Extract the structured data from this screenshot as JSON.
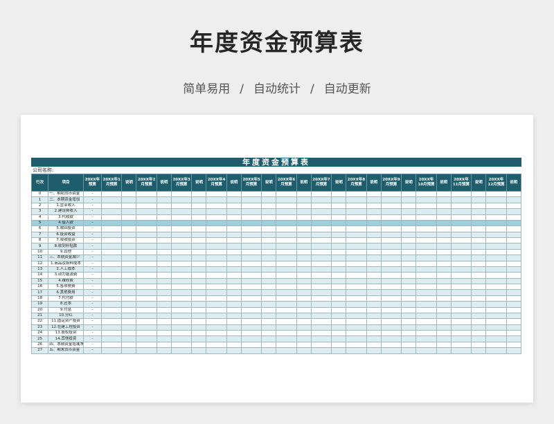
{
  "header": {
    "title": "年度资金预算表",
    "subtitle_parts": [
      "简单易用",
      "自动统计",
      "自动更新"
    ],
    "separator": "/"
  },
  "sheet": {
    "banner_title": "年度资金预算表",
    "company_label": "公司名称:",
    "columns": [
      "行次",
      "项目",
      "20XX年预算",
      "20XX年1月预算",
      "说明",
      "20XX年2月预算",
      "说明",
      "20XX年3月预算",
      "说明",
      "20XX年4月预算",
      "说明",
      "20XX年5月预算",
      "说明",
      "20XX年6月预算",
      "说明",
      "20XX年7月预算",
      "说明",
      "20XX年8月预算",
      "说明",
      "20XX年9月预算",
      "说明",
      "20XX年10月预算",
      "说明",
      "20XX年11月预算",
      "说明",
      "20XX年12月预算",
      "说明"
    ],
    "empty_value": "-",
    "rows": [
      {
        "no": "0",
        "item": "一、期初货币资金",
        "level": 0
      },
      {
        "no": "1",
        "item": "二、本期资金增加",
        "level": 0
      },
      {
        "no": "2",
        "item": "1.营业收入",
        "level": 1
      },
      {
        "no": "3",
        "item": "2.建设费收入",
        "level": 1
      },
      {
        "no": "4",
        "item": "3.代收款",
        "level": 1
      },
      {
        "no": "5",
        "item": "4.借入款",
        "level": 1
      },
      {
        "no": "6",
        "item": "5.收回投资",
        "level": 1
      },
      {
        "no": "7",
        "item": "6.投资收益",
        "level": 1
      },
      {
        "no": "8",
        "item": "7.吸收投资",
        "level": 1
      },
      {
        "no": "9",
        "item": "8.收到补贴款",
        "level": 1
      },
      {
        "no": "10",
        "item": "9.其他",
        "level": 1
      },
      {
        "no": "11",
        "item": "三、本期资金减少",
        "level": 0
      },
      {
        "no": "12",
        "item": "1.商品及拆料成本",
        "level": 1
      },
      {
        "no": "13",
        "item": "2.人工成本",
        "level": 1
      },
      {
        "no": "14",
        "item": "3.动力能源费",
        "level": 1
      },
      {
        "no": "15",
        "item": "4.维修费",
        "level": 1
      },
      {
        "no": "16",
        "item": "5.各项税费",
        "level": 1
      },
      {
        "no": "17",
        "item": "6.其他费用",
        "level": 1
      },
      {
        "no": "18",
        "item": "7.代付款",
        "level": 1
      },
      {
        "no": "19",
        "item": "8.还本",
        "level": 1
      },
      {
        "no": "20",
        "item": "9.付息",
        "level": 1
      },
      {
        "no": "21",
        "item": "10.分红",
        "level": 1
      },
      {
        "no": "22",
        "item": "11.固定资产投资",
        "level": 1
      },
      {
        "no": "23",
        "item": "12.在建工程投资",
        "level": 1
      },
      {
        "no": "24",
        "item": "13.股权投资",
        "level": 1
      },
      {
        "no": "25",
        "item": "14.其他投资",
        "level": 1
      },
      {
        "no": "26",
        "item": "四、本期资金增减净",
        "level": 0
      },
      {
        "no": "27",
        "item": "五、期末货币资金",
        "level": 0
      }
    ],
    "highlight_row": "5",
    "colors": {
      "header_bg": "#1e5d6c",
      "stripe": "#dcecf0",
      "highlight": "#9ccfd9"
    }
  }
}
